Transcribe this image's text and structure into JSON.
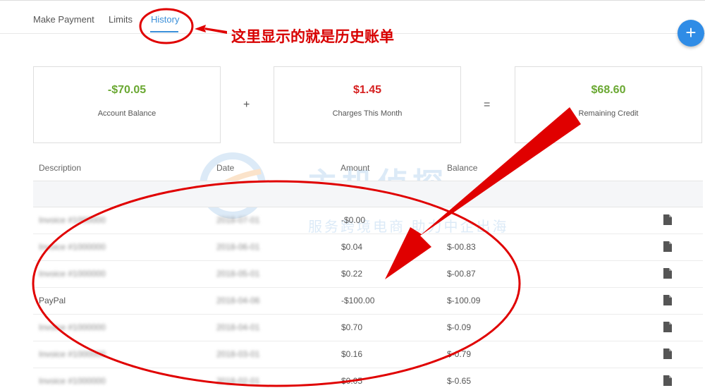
{
  "tabs": [
    {
      "label": "Make Payment",
      "active": false
    },
    {
      "label": "Limits",
      "active": false
    },
    {
      "label": "History",
      "active": true
    }
  ],
  "fab_label": "+",
  "annotation": "这里显示的就是历史账单",
  "summary": {
    "balance": {
      "amount": "-$70.05",
      "label": "Account Balance"
    },
    "plus": "+",
    "charges": {
      "amount": "$1.45",
      "label": "Charges This Month"
    },
    "equals": "=",
    "credit": {
      "amount": "$68.60",
      "label": "Remaining Credit"
    }
  },
  "table": {
    "headers": [
      "Description",
      "Date",
      "Amount",
      "Balance"
    ],
    "rows": [
      {
        "description": "Invoice #1000000",
        "date": "2018-07-01",
        "amount": "-$0.00",
        "balance": ""
      },
      {
        "description": "Invoice #1000000",
        "date": "2018-06-01",
        "amount": "$0.04",
        "balance": "$-00.83"
      },
      {
        "description": "Invoice #1000000",
        "date": "2018-05-01",
        "amount": "$0.22",
        "balance": "$-00.87"
      },
      {
        "description": "PayPal",
        "date": "2018-04-06",
        "amount": "-$100.00",
        "balance": "$-100.09"
      },
      {
        "description": "Invoice #1000000",
        "date": "2018-04-01",
        "amount": "$0.70",
        "balance": "$-0.09"
      },
      {
        "description": "Invoice #1000000",
        "date": "2018-03-01",
        "amount": "$0.16",
        "balance": "$-0.79"
      },
      {
        "description": "Invoice #1000000",
        "date": "2018-02-01",
        "amount": "$0.05",
        "balance": "$-0.65"
      }
    ]
  },
  "watermark": {
    "title": "主机侦探",
    "subtitle": "服务跨境电商 助力中企出海"
  },
  "colors": {
    "accent": "#3a8fd9",
    "positive": "#6aa832",
    "negative": "#d62020",
    "annotation": "#d80000"
  },
  "icons": {
    "document": "document-icon",
    "add": "plus-icon"
  }
}
